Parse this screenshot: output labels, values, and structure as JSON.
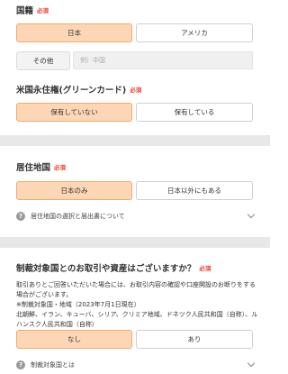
{
  "nationality": {
    "label": "国籍",
    "required": "必須",
    "options": [
      "日本",
      "アメリカ"
    ],
    "selected": "日本",
    "other_button": "その他",
    "other_placeholder": "例）中国"
  },
  "green_card": {
    "label": "米国永住権(グリーンカード)",
    "required": "必須",
    "options": [
      "保有していない",
      "保有している"
    ],
    "selected": "保有していない"
  },
  "residence": {
    "label": "居住地国",
    "required": "必須",
    "options": [
      "日本のみ",
      "日本以外にもある"
    ],
    "selected": "日本のみ",
    "help_link": "居住地国の選択と届出書について"
  },
  "sanctions": {
    "label": "制裁対象国とのお取引や資産はございますか？",
    "required": "必須",
    "description_lines": [
      "取引ありとご回答いただいた場合には、お取引内容の確認や口座開設のお断りをする",
      "場合がございます。",
      "※制裁対象国・地域（2023年7月1日現在）",
      "北朝鮮、イラン、キューバ、シリア、クリミア地域、ドネツク人民共和国（自称）、ル",
      "ハンスク人民共和国（自称）"
    ],
    "options": [
      "なし",
      "あり"
    ],
    "selected": "なし",
    "help_link": "制裁対象国とは"
  },
  "icons": {
    "help": "question-circle-icon",
    "expand": "chevron-down-icon"
  },
  "colors": {
    "selected_bg": "#fdd7b5",
    "selected_border": "#f3a96a",
    "required_text": "#e8412c",
    "section_divider": "#e8e8e8"
  }
}
